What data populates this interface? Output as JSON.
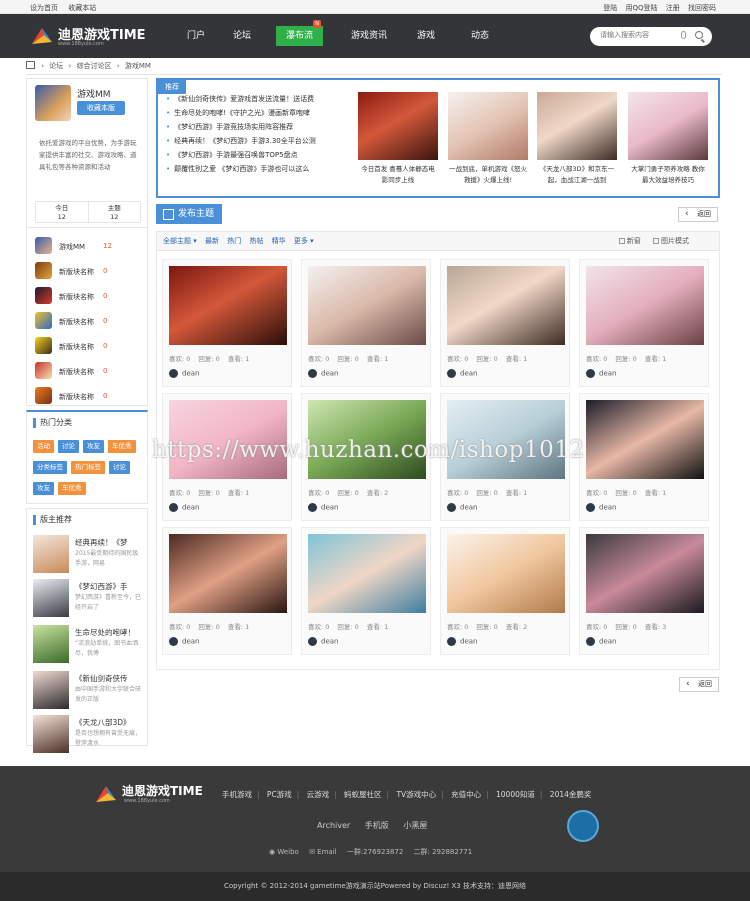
{
  "topbar": {
    "left": [
      "设为首页",
      "收藏本站"
    ],
    "right": [
      "登陆",
      "用QQ登陆",
      "注册",
      "找回密码"
    ]
  },
  "header": {
    "logo_text": "迪恩游戏TIME",
    "logo_url": "www.188yule.com",
    "nav": [
      "门户",
      "论坛",
      "瀑布流",
      "游戏资讯",
      "游戏",
      "动态"
    ],
    "nav_active_badge": "N",
    "search_placeholder": "请输入搜索内容"
  },
  "breadcrumb": [
    "论坛",
    "综合讨论区",
    "游戏MM"
  ],
  "profile": {
    "name": "游戏MM",
    "button": "收藏本版",
    "desc": "依托爱游戏的平台优势，为手游玩家提供丰富的社交、游戏攻略、道具礼包等各种资源和活动",
    "today_label": "今日",
    "today": "12",
    "topic_label": "主题",
    "topic": "12"
  },
  "boards": [
    {
      "name": "游戏MM",
      "count": "12"
    },
    {
      "name": "新版块名称",
      "count": "0"
    },
    {
      "name": "新版块名称",
      "count": "0"
    },
    {
      "name": "新版块名称",
      "count": "0"
    },
    {
      "name": "新版块名称",
      "count": "0"
    },
    {
      "name": "新版块名称",
      "count": "0"
    },
    {
      "name": "新版块名称",
      "count": "0"
    }
  ],
  "hot": {
    "title": "热门分类",
    "tags": [
      "活动",
      "讨论",
      "攻友",
      "车优秀",
      "分类标签",
      "热门标签",
      "讨论",
      "攻友",
      "车优秀"
    ]
  },
  "recommend": {
    "title": "版主推荐",
    "items": [
      {
        "title": "经典再续！《梦",
        "sub": "2015最受期待的国民级手游，网易"
      },
      {
        "title": "《梦幻西游》手",
        "sub": "梦幻西游》喜新至今，已经开启了"
      },
      {
        "title": "生命尽处的咆哮！",
        "sub": "“流浪劫单挑，图书血洒尽，我傅"
      },
      {
        "title": "《新仙剑奇侠传",
        "sub": "由中国手游和大宇联合研发的正版"
      },
      {
        "title": "《天龙八部3D》",
        "sub": "是否也想拥有曾受无痕，登萍渡水"
      }
    ]
  },
  "slide": {
    "tag": "推荐",
    "list": [
      "《新仙剑奇侠传》爱游戏首发送流量！送话费",
      "生命尽处的咆哮!《守护之光》漫画新章咆哮",
      "《梦幻西游》手游竞技场实用阵容推荐",
      "经典再续！《梦幻西游》手游3.30全平台公测",
      "《梦幻西游》手游最强召唤兽TOP5盘点",
      "颠覆性别之爱 《梦幻西游》手游也可以这么"
    ],
    "shots": [
      "今日首发 喜蓦人体静态电影同步上线",
      "一战到底，单机游戏《怒火救援》火爆上线!",
      "《天龙八部3D》和京东一起，血战江湖一战到",
      "大掌门勇子项养攻略 教你最大效益培养技巧"
    ]
  },
  "post_button": "发布主题",
  "back": "返回",
  "filter": {
    "left": [
      "全部主题 ▾",
      "最新",
      "热门",
      "热帖",
      "精华",
      "更多 ▾"
    ],
    "new_label": "新窗",
    "pic_label": "图片模式"
  },
  "cards": [
    {
      "likes": "0",
      "replies": "0",
      "views": "1",
      "user": "dean"
    },
    {
      "likes": "0",
      "replies": "0",
      "views": "1",
      "user": "dean"
    },
    {
      "likes": "0",
      "replies": "0",
      "views": "1",
      "user": "dean"
    },
    {
      "likes": "0",
      "replies": "0",
      "views": "1",
      "user": "dean"
    },
    {
      "likes": "0",
      "replies": "0",
      "views": "1",
      "user": "dean"
    },
    {
      "likes": "0",
      "replies": "0",
      "views": "2",
      "user": "dean"
    },
    {
      "likes": "0",
      "replies": "0",
      "views": "1",
      "user": "dean"
    },
    {
      "likes": "0",
      "replies": "0",
      "views": "1",
      "user": "dean"
    },
    {
      "likes": "0",
      "replies": "0",
      "views": "1",
      "user": "dean"
    },
    {
      "likes": "0",
      "replies": "0",
      "views": "1",
      "user": "dean"
    },
    {
      "likes": "0",
      "replies": "0",
      "views": "2",
      "user": "dean"
    },
    {
      "likes": "0",
      "replies": "0",
      "views": "3",
      "user": "dean"
    }
  ],
  "card_labels": {
    "likes": "喜欢:",
    "replies": "回复:",
    "views": "查看:"
  },
  "footer": {
    "links": [
      "手机游戏",
      "PC游戏",
      "云游戏",
      "蚂蚁屋社区",
      "TV游戏中心",
      "充值中心",
      "10000知道",
      "2014金鹏奖"
    ],
    "links2": [
      "Archiver",
      "手机版",
      "小黑屋"
    ],
    "contact": [
      "Weibo",
      "Email",
      "一群:276923872",
      "二群: 292882771"
    ],
    "copyright": "Copyright © 2012-2014 gametime游戏演示站Powered by Discuz! X3  技术支持：迪恩网络"
  },
  "watermark": "https://www.huzhan.com/ishop1012",
  "colors": {
    "accent": "#4a90d9",
    "header": "#333538",
    "active": "#2fb04a",
    "tag": "#f3913c",
    "count": "#e4572e"
  }
}
